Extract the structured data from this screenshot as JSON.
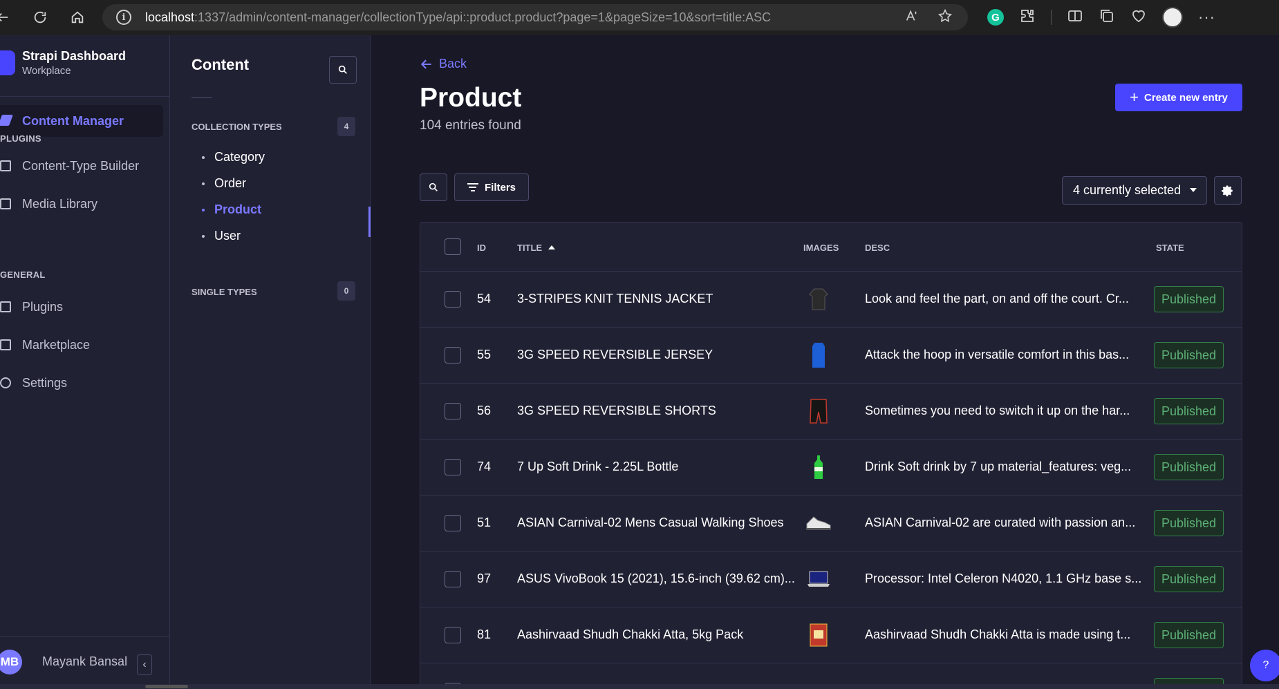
{
  "browser": {
    "url_host": "localhost",
    "url_rest": ":1337/admin/content-manager/collectionType/api::product.product?page=1&pageSize=10&sort=title:ASC"
  },
  "brand": {
    "title": "Strapi Dashboard",
    "subtitle": "Workplace"
  },
  "main_nav": {
    "active_item": "Content Manager",
    "plugins_label": "PLUGINS",
    "plugins": [
      "Content-Type Builder",
      "Media Library"
    ],
    "general_label": "GENERAL",
    "general": [
      "Plugins",
      "Marketplace",
      "Settings"
    ]
  },
  "user": {
    "initials": "MB",
    "name": "Mayank Bansal"
  },
  "sub_nav": {
    "title": "Content",
    "collection_types_label": "COLLECTION TYPES",
    "collection_types_count": "4",
    "collection_types": [
      "Category",
      "Order",
      "Product",
      "User"
    ],
    "single_types_label": "SINGLE TYPES",
    "single_types_count": "0"
  },
  "header": {
    "back_label": "Back",
    "title": "Product",
    "entries_found": "104 entries found",
    "create_label": "Create new entry"
  },
  "toolbar": {
    "filters_label": "Filters",
    "columns_selected": "4 currently selected"
  },
  "table": {
    "columns": {
      "id": "ID",
      "title": "TITLE",
      "images": "IMAGES",
      "desc": "DESC",
      "state": "STATE"
    },
    "rows": [
      {
        "id": "54",
        "title": "3-STRIPES KNIT TENNIS JACKET",
        "desc": "Look and feel the part, on and off the court. Cr...",
        "state": "Published"
      },
      {
        "id": "55",
        "title": "3G SPEED REVERSIBLE JERSEY",
        "desc": "Attack the hoop in versatile comfort in this bas...",
        "state": "Published"
      },
      {
        "id": "56",
        "title": "3G SPEED REVERSIBLE SHORTS",
        "desc": "Sometimes you need to switch it up on the har...",
        "state": "Published"
      },
      {
        "id": "74",
        "title": "7 Up Soft Drink - 2.25L Bottle",
        "desc": "Drink Soft drink by 7 up material_features: veg...",
        "state": "Published"
      },
      {
        "id": "51",
        "title": "ASIAN Carnival-02 Mens Casual Walking Shoes",
        "desc": "ASIAN Carnival-02 are curated with passion an...",
        "state": "Published"
      },
      {
        "id": "97",
        "title": "ASUS VivoBook 15 (2021), 15.6-inch (39.62 cm)...",
        "desc": "Processor: Intel Celeron N4020, 1.1 GHz base s...",
        "state": "Published"
      },
      {
        "id": "81",
        "title": "Aashirvaad Shudh Chakki Atta, 5kg Pack",
        "desc": "Aashirvaad Shudh Chakki Atta is made using t...",
        "state": "Published"
      }
    ]
  },
  "help": {
    "label": "?"
  }
}
